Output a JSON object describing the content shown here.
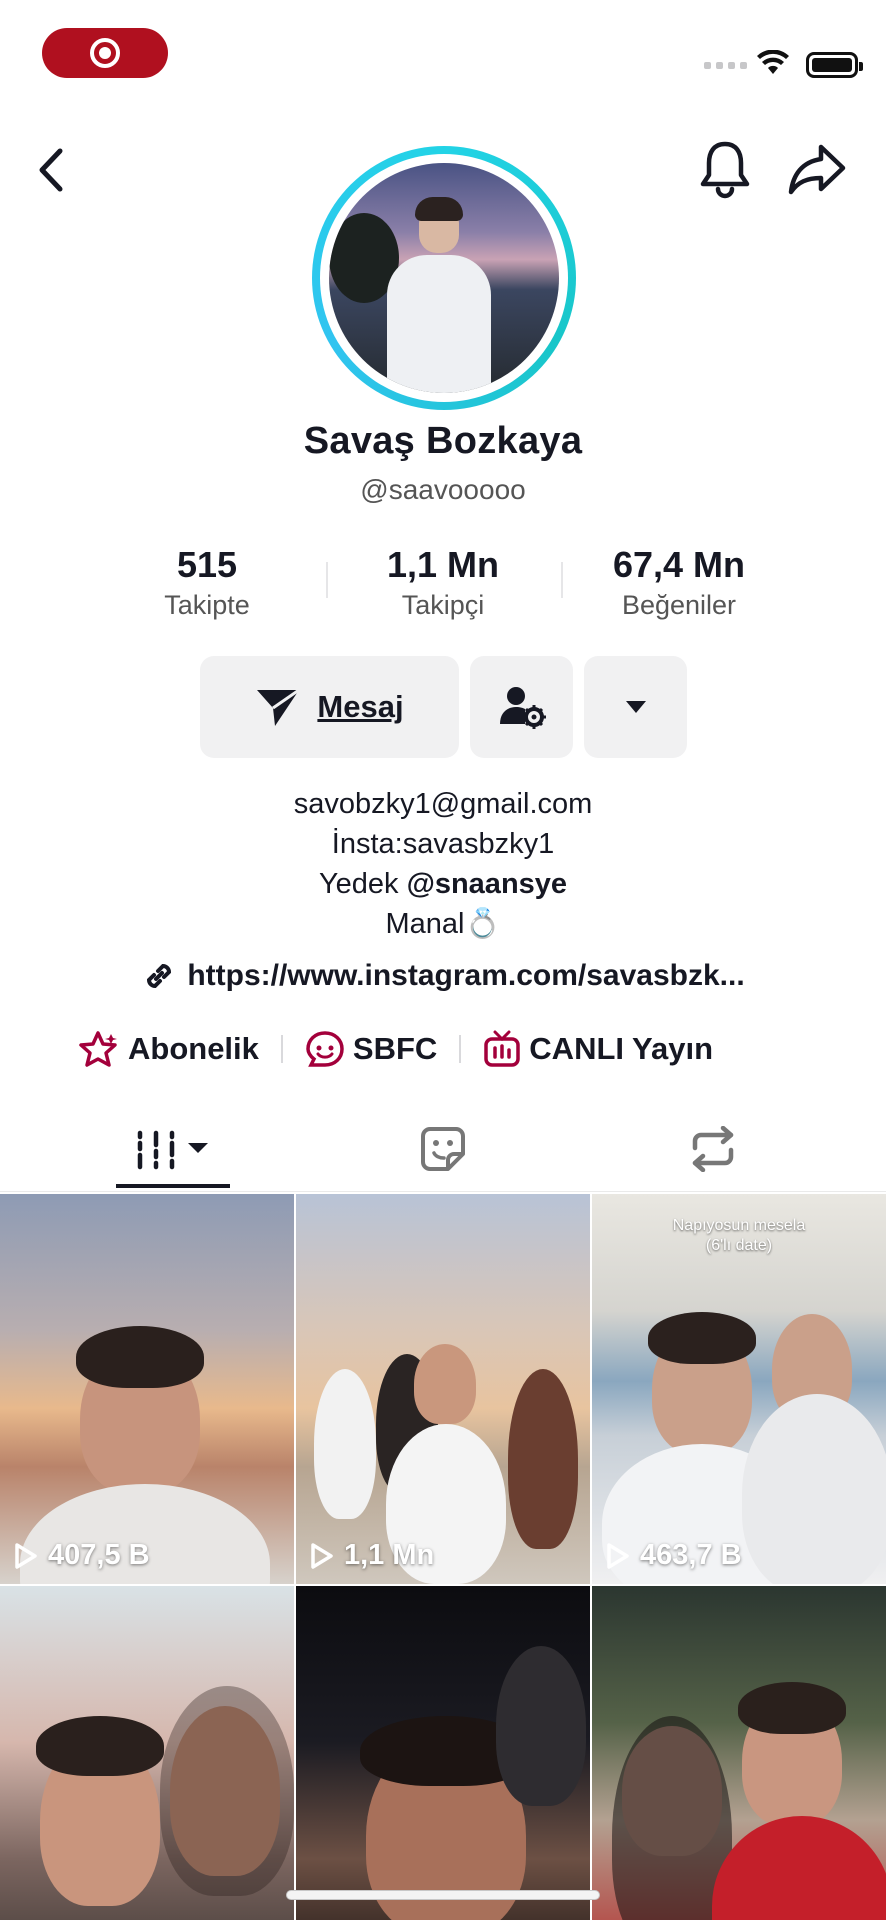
{
  "status_bar": {
    "recording_icon": "record-icon",
    "wifi_icon": "wifi-icon",
    "battery_icon": "battery-icon"
  },
  "nav": {
    "back_icon": "chevron-left-icon",
    "bell_icon": "bell-icon",
    "share_icon": "share-arrow-icon"
  },
  "profile": {
    "name": "Savaş Bozkaya",
    "handle": "@saavooooo",
    "ring_color": "#22d3e6"
  },
  "stats": [
    {
      "value": "515",
      "label": "Takipte"
    },
    {
      "value": "1,1 Mn",
      "label": "Takipçi"
    },
    {
      "value": "67,4 Mn",
      "label": "Beğeniler"
    }
  ],
  "actions": {
    "message_label": "Mesaj",
    "message_icon": "send-icon",
    "friend_settings_icon": "user-settings-icon",
    "more_icon": "caret-down-icon"
  },
  "bio": {
    "line1": "savobzky1@gmail.com",
    "line2": "İnsta:savasbzky1",
    "line3_prefix": "Yedek ",
    "line3_mention": "@snaansye",
    "line4": "Manal💍"
  },
  "link": {
    "text": "https://www.instagram.com/savasbzk...",
    "icon": "link-icon"
  },
  "features": [
    {
      "label": "Abonelik",
      "icon": "star-badge-icon"
    },
    {
      "label": "SBFC",
      "icon": "fan-club-icon"
    },
    {
      "label": "CANLI Yayın",
      "icon": "live-tv-icon"
    }
  ],
  "accent_color": "#a3003b",
  "tabs": [
    {
      "icon": "videos-grid-icon",
      "active": true
    },
    {
      "icon": "sticker-icon",
      "active": false
    },
    {
      "icon": "repost-icon",
      "active": false
    }
  ],
  "videos": [
    {
      "views": "407,5 B"
    },
    {
      "views": "1,1 Mn"
    },
    {
      "views": "463,7 B",
      "caption_line1": "Napıyosun mesela",
      "caption_line2": "(6'lı date)"
    },
    {
      "views": ""
    },
    {
      "views": ""
    },
    {
      "views": ""
    }
  ]
}
